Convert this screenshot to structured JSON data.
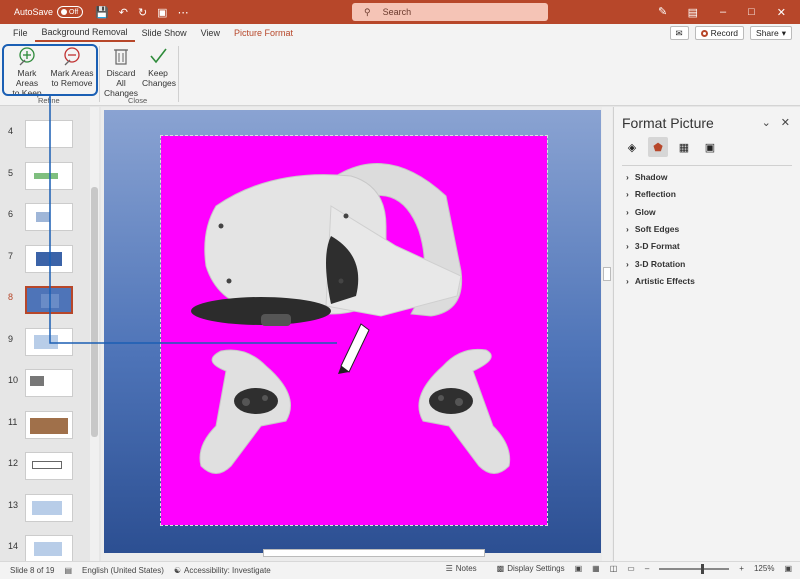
{
  "titlebar": {
    "autosave_label": "AutoSave",
    "autosave_state": "Off",
    "search_placeholder": "Search",
    "icons": [
      "save-icon",
      "undo-icon",
      "redo-icon",
      "present-icon",
      "pen-icon",
      "ribbon-options-icon",
      "minimize-icon",
      "maximize-icon",
      "close-icon"
    ]
  },
  "menu": {
    "tabs": [
      "File",
      "Background Removal",
      "Slide Show",
      "View",
      "Picture Format"
    ],
    "record_label": "Record",
    "share_label": "Share"
  },
  "ribbon": {
    "keep_label_1": "Mark Areas",
    "keep_label_2": "to Keep",
    "remove_label_1": "Mark Areas",
    "remove_label_2": "to Remove",
    "discard_label_1": "Discard All",
    "discard_label_2": "Changes",
    "keepchanges_label_1": "Keep",
    "keepchanges_label_2": "Changes",
    "group_refine": "Refine",
    "group_close": "Close"
  },
  "thumbnails": [
    {
      "num": "4"
    },
    {
      "num": "5"
    },
    {
      "num": "6"
    },
    {
      "num": "7"
    },
    {
      "num": "8"
    },
    {
      "num": "9"
    },
    {
      "num": "10"
    },
    {
      "num": "11"
    },
    {
      "num": "12"
    },
    {
      "num": "13"
    },
    {
      "num": "14"
    }
  ],
  "selected_slide": "8",
  "format_pane": {
    "title": "Format Picture",
    "sections": [
      "Shadow",
      "Reflection",
      "Glow",
      "Soft Edges",
      "3-D Format",
      "3-D Rotation",
      "Artistic Effects"
    ]
  },
  "statusbar": {
    "slide_info": "Slide 8 of 19",
    "language": "English (United States)",
    "accessibility": "Accessibility: Investigate",
    "notes": "Notes",
    "display_settings": "Display Settings",
    "zoom": "125%"
  },
  "colors": {
    "accent": "#b7472a",
    "magenta": "#ff00ff",
    "annotation": "#1a5fb4"
  }
}
